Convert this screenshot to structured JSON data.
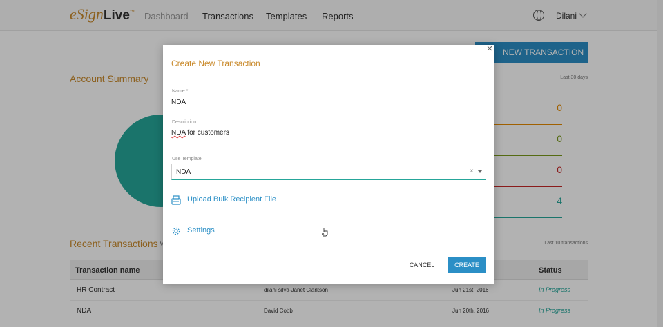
{
  "header": {
    "logo": {
      "prefix": "eSign",
      "suffix": "Live",
      "mark": "™"
    },
    "nav": [
      "Dashboard",
      "Transactions",
      "Templates",
      "Reports"
    ],
    "user": "Dilani",
    "icons": {
      "language": "globe-icon",
      "menu": "chevron-down-icon"
    }
  },
  "dashboard": {
    "new_transaction_button": "NEW TRANSACTION",
    "account_summary_title": "Account Summary",
    "period": "Last 30 days",
    "stats": [
      {
        "value": "0",
        "color": "#e68a00"
      },
      {
        "value": "0",
        "color": "#7a9a1a"
      },
      {
        "value": "0",
        "color": "#c62828"
      },
      {
        "value": "4",
        "color": "#26a69a"
      }
    ],
    "recent_title": "Recent Transactions",
    "recent_sub": "V",
    "recent_period": "Last 10 transactions",
    "table": {
      "columns": [
        "Transaction name",
        "Status"
      ],
      "rows": [
        {
          "name": "HR Contract",
          "signers": "dilani silva-Janet Clarkson",
          "date": "Jun 21st, 2016",
          "status": "In Progress"
        },
        {
          "name": "NDA",
          "signers": "David Cobb",
          "date": "Jun 20th, 2016",
          "status": "In Progress"
        }
      ]
    }
  },
  "modal": {
    "title": "Create New Transaction",
    "close_icon": "close-icon",
    "name_field": {
      "label": "Name *",
      "value": "NDA"
    },
    "description_field": {
      "label": "Description",
      "value_first": "NDA",
      "value_rest": " for customers"
    },
    "template_field": {
      "label": "Use Template",
      "value": "NDA",
      "clear": "×"
    },
    "upload_link": {
      "label": "Upload Bulk Recipient File",
      "icon": "upload-file-icon"
    },
    "settings_link": {
      "label": "Settings",
      "icon": "gear-icon"
    },
    "cancel_label": "CANCEL",
    "create_label": "CREATE"
  },
  "colors": {
    "accent": "#2b8fc6",
    "brand": "#c98a2c",
    "success": "#26a69a"
  }
}
